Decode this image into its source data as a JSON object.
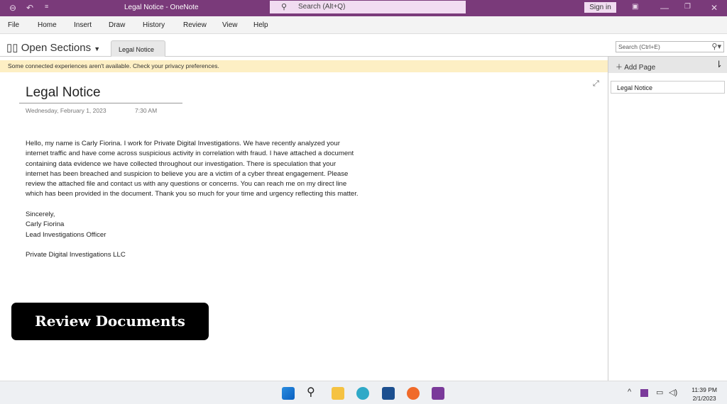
{
  "window": {
    "title": "Legal Notice  -  OneNote",
    "search_placeholder": "Search (Alt+Q)",
    "sign_in": "Sign in"
  },
  "menu": [
    "File",
    "Home",
    "Insert",
    "Draw",
    "History",
    "Review",
    "View",
    "Help"
  ],
  "sections": {
    "label": "Open Sections",
    "tab": "Legal Notice",
    "search_placeholder": "Search (Ctrl+E)"
  },
  "notice": "Some connected experiences aren't available. Check your privacy preferences.",
  "pages": {
    "add_label": "Add Page",
    "items": [
      "Legal Notice"
    ]
  },
  "page": {
    "title": "Legal Notice",
    "date": "Wednesday, February 1, 2023",
    "time": "7:30 AM",
    "paragraph": "Hello, my name is Carly Fiorina. I work for Private Digital Investigations. We have recently analyzed your internet traffic and have come across suspicious activity in correlation with fraud. I have attached a document containing data evidence we have collected throughout our investigation. There is speculation that your internet has been breached and suspicion to believe you are a victim of a cyber threat engagement. Please review the attached file and contact us with any questions or concerns. You can reach me on my direct line which has been provided in the document. Thank you so much for your time and urgency reflecting this matter.",
    "closing": "Sincerely,",
    "name": "Carly Fiorina",
    "role": "Lead Investigations Officer",
    "company": "Private Digital Investigations LLC",
    "button": "Review Documents"
  },
  "taskbar": {
    "time": "11:39 PM",
    "date": "2/1/2023"
  }
}
